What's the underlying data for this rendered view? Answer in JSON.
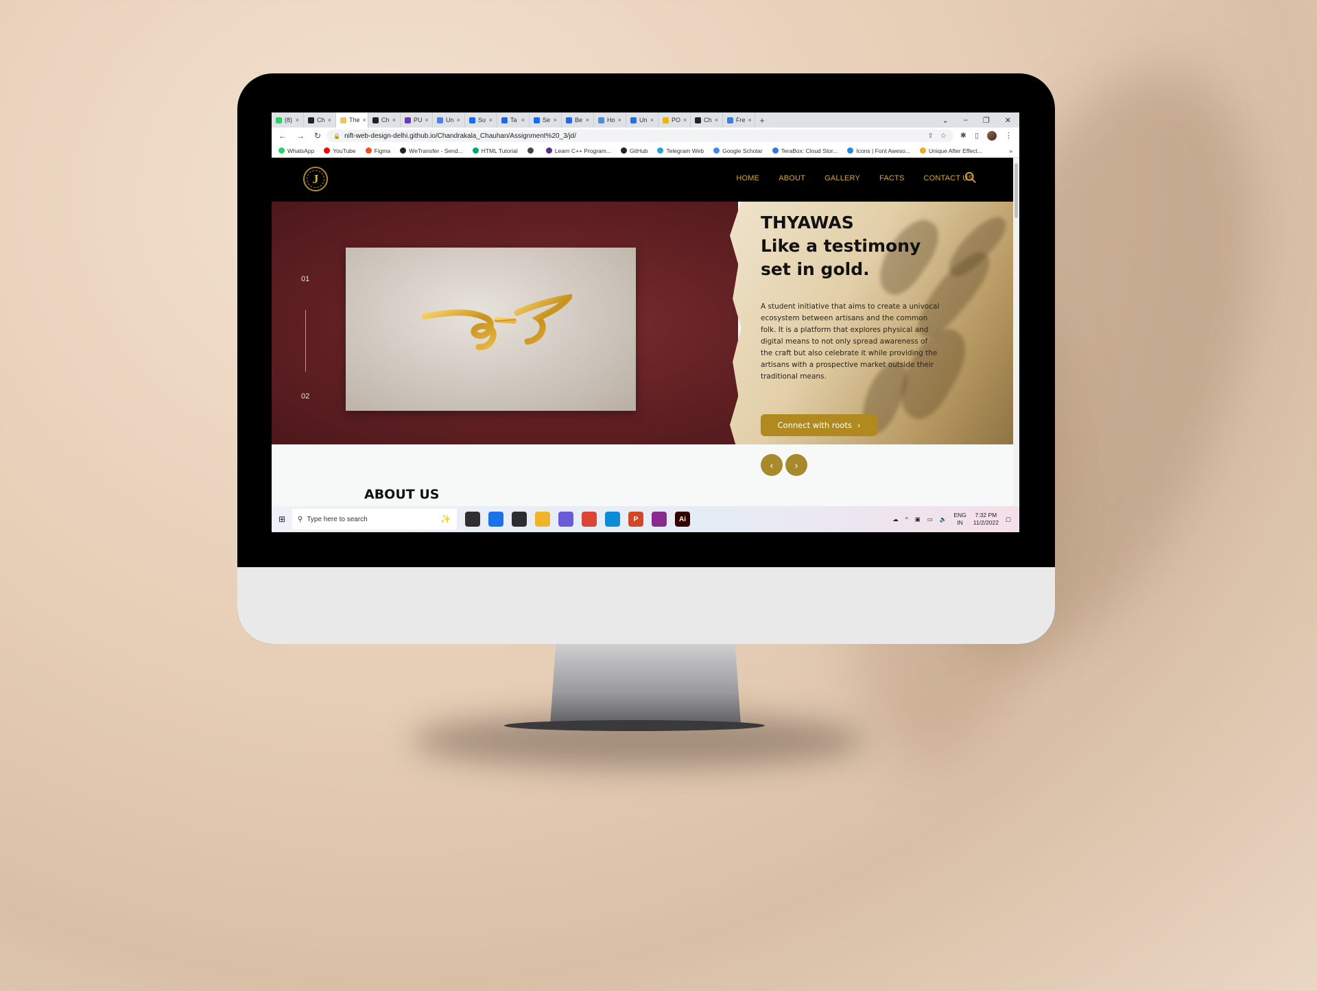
{
  "browser": {
    "tabs": [
      {
        "label": "(8)",
        "icon": "whatsapp-icon",
        "color": "#25d366"
      },
      {
        "label": "Ch",
        "icon": "github-icon",
        "color": "#222222"
      },
      {
        "label": "The",
        "icon": "site-icon",
        "color": "#e8c46a",
        "active": true
      },
      {
        "label": "Ch",
        "icon": "github-icon",
        "color": "#222222"
      },
      {
        "label": "PU",
        "icon": "form-icon",
        "color": "#673ab7"
      },
      {
        "label": "Un",
        "icon": "docs-icon",
        "color": "#4285f4"
      },
      {
        "label": "Su",
        "icon": "behance-icon",
        "color": "#1769ff"
      },
      {
        "label": "Ta",
        "icon": "behance-icon",
        "color": "#1769ff"
      },
      {
        "label": "Se",
        "icon": "behance-icon",
        "color": "#1769ff"
      },
      {
        "label": "Be",
        "icon": "behance-icon",
        "color": "#1769ff"
      },
      {
        "label": "Ho",
        "icon": "globe-icon",
        "color": "#4a90d9"
      },
      {
        "label": "Un",
        "icon": "chrome-icon",
        "color": "#1a73e8"
      },
      {
        "label": "PO",
        "icon": "drive-icon",
        "color": "#f4b400"
      },
      {
        "label": "Ch",
        "icon": "github-icon",
        "color": "#222222"
      },
      {
        "label": "Fre",
        "icon": "shield-icon",
        "color": "#3d7be0"
      }
    ],
    "tab_close": "×",
    "new_tab": "+",
    "url": "nift-web-design-delhi.github.io/Chandrakala_Chauhan/Assignment%20_3/jd/",
    "bookmarks": [
      {
        "label": "WhatsApp",
        "color": "#25d366"
      },
      {
        "label": "YouTube",
        "color": "#ff0000"
      },
      {
        "label": "Figma",
        "color": "#f24e1e"
      },
      {
        "label": "WeTransfer - Send...",
        "color": "#222222"
      },
      {
        "label": "HTML Tutorial",
        "color": "#04aa6d"
      },
      {
        "label": "",
        "color": "#444444"
      },
      {
        "label": "Learn C++ Program...",
        "color": "#5a2d91"
      },
      {
        "label": "GitHub",
        "color": "#222222"
      },
      {
        "label": "Telegram Web",
        "color": "#2aa1da"
      },
      {
        "label": "Google Scholar",
        "color": "#4285f4"
      },
      {
        "label": "TeraBox: Cloud Stor...",
        "color": "#3578e5"
      },
      {
        "label": "Icons | Font Aweso...",
        "color": "#228ae6"
      },
      {
        "label": "Unique After Effect...",
        "color": "#f5a623"
      }
    ],
    "more_bookmarks": "»"
  },
  "site": {
    "logo_letter": "J",
    "nav": [
      "HOME",
      "ABOUT",
      "GALLERY",
      "FACTS",
      "CONTACT US"
    ],
    "slider": {
      "index_top": "01",
      "index_bottom": "02"
    },
    "hero": {
      "title_line1": "THYAWAS",
      "title_line2": "Like a testimony",
      "title_line3": "set in gold.",
      "description": "A student initiative that aims to create a univocal ecosystem between artisans and the common folk. It is a platform that explores physical and digital means to not only spread awareness of the craft but also celebrate it while providing the artisans with a prospective market outside their traditional means.",
      "cta_label": "Connect with roots",
      "cta_arrow": "›"
    },
    "arrows": {
      "prev": "‹",
      "next": "›"
    },
    "about_title": "ABOUT US",
    "colors": {
      "gold": "#d8a93a",
      "maroon": "#5f1f22",
      "button": "#b08a1f"
    }
  },
  "taskbar": {
    "search_placeholder": "Type here to search",
    "apps": [
      {
        "name": "obs-app",
        "color": "#302e31",
        "label": ""
      },
      {
        "name": "chrome-app",
        "color": "#1a73e8",
        "label": ""
      },
      {
        "name": "vscode-app",
        "color": "#2c2c32",
        "label": ""
      },
      {
        "name": "explorer-app",
        "color": "#f0b429",
        "label": ""
      },
      {
        "name": "canva-app",
        "color": "#6b5bd6",
        "label": ""
      },
      {
        "name": "chrome-profile-app",
        "color": "#db4437",
        "label": ""
      },
      {
        "name": "edge-app",
        "color": "#0c8bd8",
        "label": ""
      },
      {
        "name": "powerpoint-app",
        "color": "#d24726",
        "label": "P"
      },
      {
        "name": "winrar-app",
        "color": "#8a2a8f",
        "label": ""
      },
      {
        "name": "illustrator-app",
        "color": "#330000",
        "label": "Ai"
      }
    ],
    "lang_top": "ENG",
    "lang_bottom": "IN",
    "time": "7:32 PM",
    "date": "11/2/2022"
  }
}
